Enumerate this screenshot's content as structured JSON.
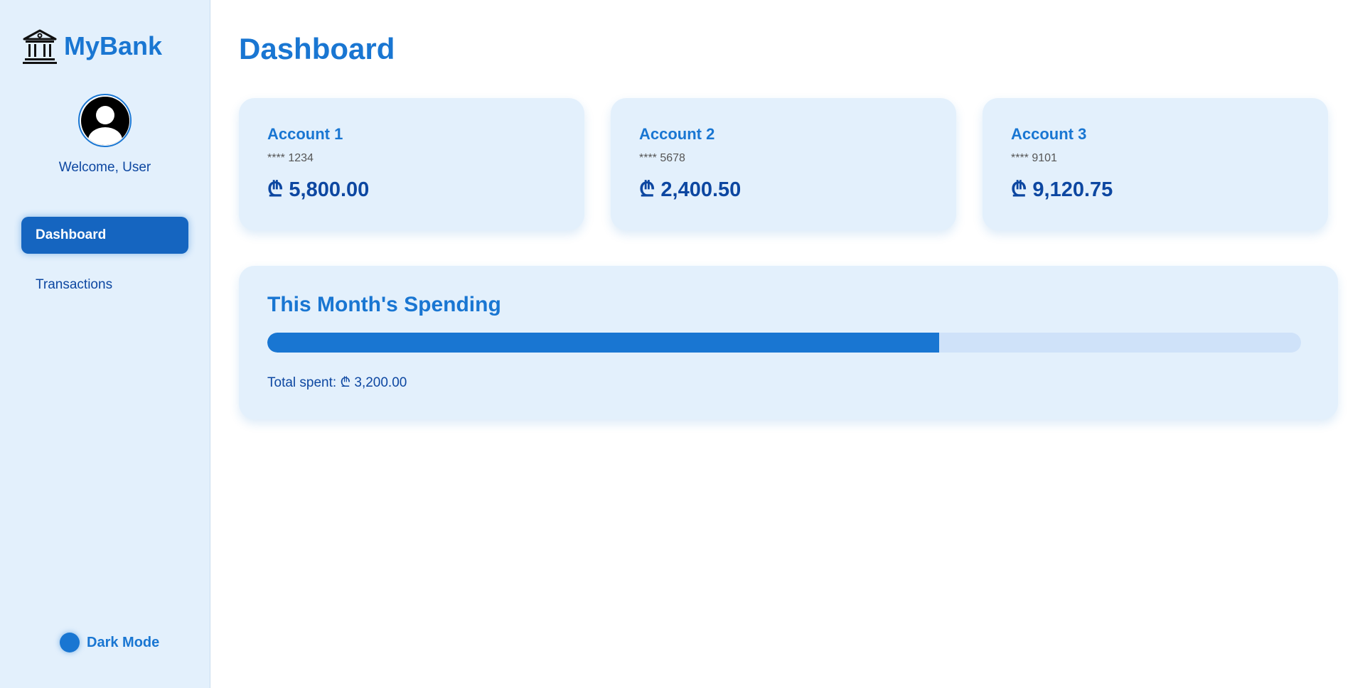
{
  "sidebar": {
    "brand_name": "MyBank",
    "brand_icon": "bank-icon",
    "avatar_icon": "user-avatar-icon",
    "welcome_text": "Welcome, User",
    "nav": [
      {
        "label": "Dashboard",
        "active": true
      },
      {
        "label": "Transactions",
        "active": false
      }
    ],
    "dark_mode_label": "Dark Mode"
  },
  "main": {
    "title": "Dashboard",
    "accounts": [
      {
        "name": "Account 1",
        "number": "**** 1234",
        "balance": "₾ 5,800.00"
      },
      {
        "name": "Account 2",
        "number": "**** 5678",
        "balance": "₾ 2,400.50"
      },
      {
        "name": "Account 3",
        "number": "**** 9101",
        "balance": "₾ 9,120.75"
      }
    ],
    "spending": {
      "title": "This Month's Spending",
      "progress_fraction": 0.65,
      "total_text": "Total spent: ₾ 3,200.00"
    }
  },
  "colors": {
    "accent": "#1976d2",
    "accent_dark": "#0d47a1",
    "panel_bg": "#e3f0fc",
    "progress_track": "#cfe2f9"
  }
}
